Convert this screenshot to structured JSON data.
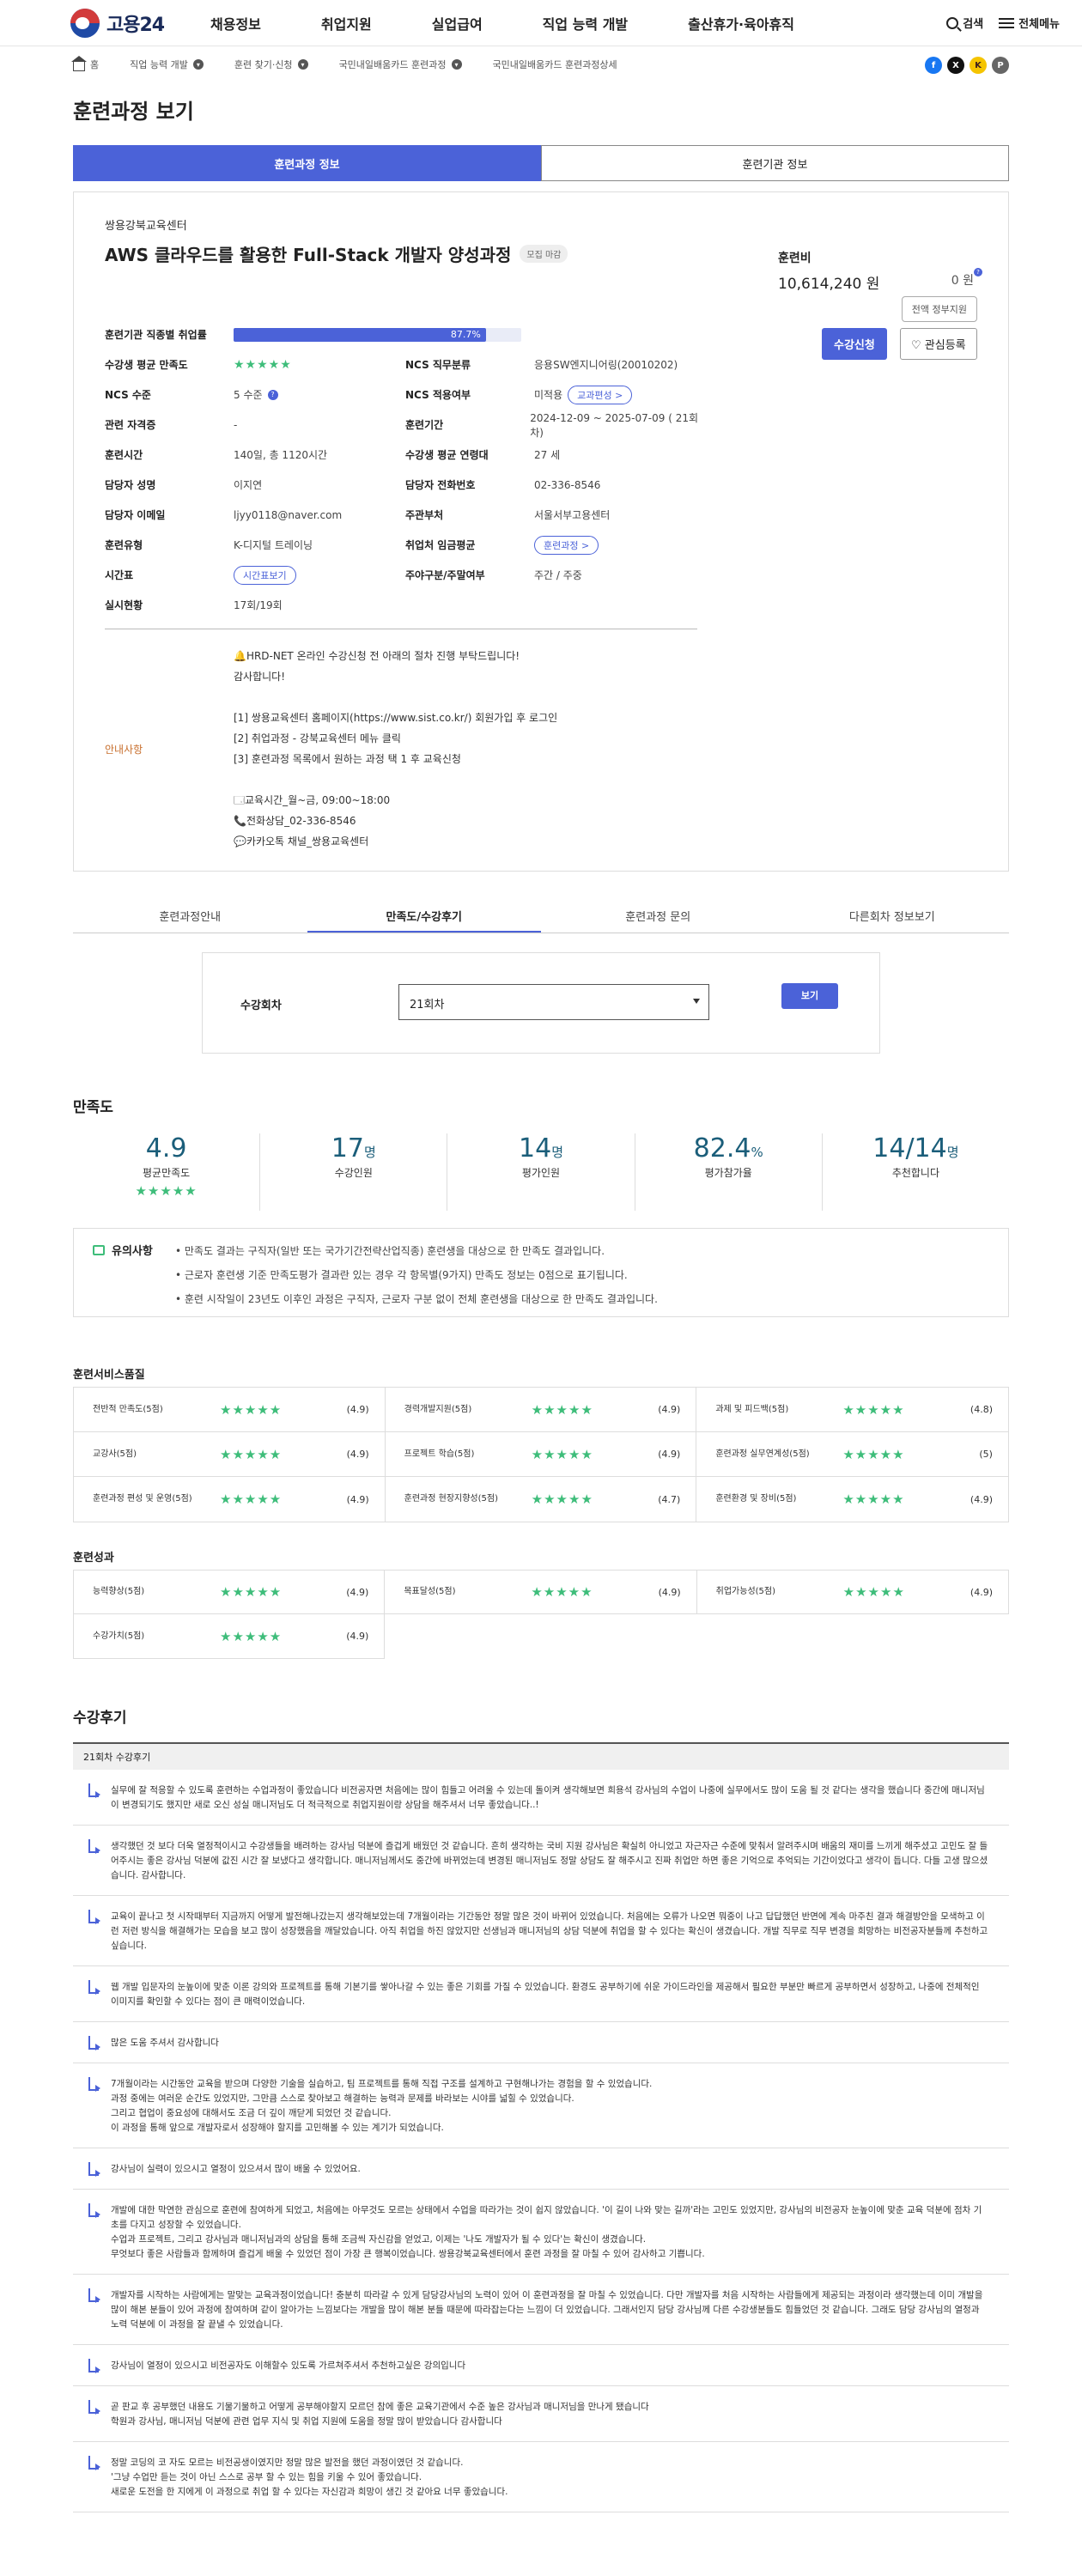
{
  "header": {
    "logo_text": "고용24",
    "menu": [
      "채용정보",
      "취업지원",
      "실업급여",
      "직업 능력 개발",
      "출산휴가·육아휴직"
    ],
    "search_label": "검색",
    "all_menu_label": "전체메뉴"
  },
  "breadcrumb": [
    "홈",
    "직업 능력 개발",
    "훈련 찾기·신청",
    "국민내일배움카드 훈련과정",
    "국민내일배움카드 훈련과정상세"
  ],
  "share": [
    "f",
    "X",
    "K",
    "P"
  ],
  "page_title": "훈련과정 보기",
  "main_tabs": [
    "훈련과정 정보",
    "훈련기관 정보"
  ],
  "course": {
    "org": "쌍용강북교육센터",
    "title": "AWS 클라우드를 활용한 Full-Stack 개발자 양성과정",
    "status": "모집 마감",
    "fee_label": "훈련비",
    "fee": "10,614,240 원",
    "self_pay": "0 원",
    "self_pay_info": "?",
    "all_pay_btn": "전액 정부지원",
    "apply_btn": "수강신청",
    "like_btn": "♡ 관심등록",
    "employment_label": "훈련기관 직종별 취업률",
    "employment_rate": 87.7,
    "employment_text": "87.7%",
    "rows": [
      [
        {
          "k": "수강생 평균 만족도",
          "v": "★★★★★",
          "type": "stars"
        },
        {
          "k": "NCS 직무분류",
          "v": "응용SW엔지니어링(20010202)"
        }
      ],
      [
        {
          "k": "NCS 수준",
          "v": "5 수준",
          "info": "?"
        },
        {
          "k": "NCS 적용여부",
          "v": "미적용",
          "pill": "교과편성 >"
        }
      ],
      [
        {
          "k": "관련 자격증",
          "v": "-"
        },
        {
          "k": "훈련기간",
          "v": "2024-12-09 ~ 2025-07-09 ( 21회차)"
        }
      ],
      [
        {
          "k": "훈련시간",
          "v": "140일, 총 1120시간"
        },
        {
          "k": "수강생 평균 연령대",
          "v": "27 세"
        }
      ],
      [
        {
          "k": "담당자 성명",
          "v": "이지연"
        },
        {
          "k": "담당자 전화번호",
          "v": "02-336-8546"
        }
      ],
      [
        {
          "k": "담당자 이메일",
          "v": "ljyy0118@naver.com"
        },
        {
          "k": "주관부처",
          "v": "서울서부고용센터"
        }
      ],
      [
        {
          "k": "훈련유형",
          "v": "K-디지털 트레이닝"
        },
        {
          "k": "취업처 임금평균",
          "v": "",
          "pill": "훈련과정 >"
        }
      ],
      [
        {
          "k": "시간표",
          "v": "",
          "pill": "시간표보기"
        },
        {
          "k": "주야구분/주말여부",
          "v": "주간 / 주중"
        }
      ],
      [
        {
          "k": "실시현황",
          "v": "17회/19회"
        }
      ]
    ],
    "notice_label": "안내사항",
    "notice_lines": [
      "🔔HRD-NET 온라인 수강신청 전 아래의 절차 진행 부탁드립니다!",
      "감사합니다!",
      "",
      "[1] 쌍용교육센터 홈페이지(https://www.sist.co.kr/) 회원가입 후 로그인",
      "[2] 취업과정 - 강북교육센터 메뉴 클릭",
      "[3] 훈련과정 목록에서 원하는 과정 택 1 후 교육신청",
      "",
      "🗔교육시간_월~금, 09:00~18:00",
      "📞전화상담_02-336-8546",
      "💬카카오톡 채널_쌍용교육센터"
    ]
  },
  "sub_tabs": [
    "훈련과정안내",
    "만족도/수강후기",
    "훈련과정 문의",
    "다른회차 정보보기"
  ],
  "round_select": {
    "label": "수강회차",
    "value": "21회차",
    "button": "보기"
  },
  "satisfaction": {
    "title": "만족도",
    "stats": [
      {
        "n": "4.9",
        "u": "",
        "l": "평균만족도",
        "stars": "★★★★★"
      },
      {
        "n": "17",
        "u": "명",
        "l": "수강인원"
      },
      {
        "n": "14",
        "u": "명",
        "l": "평가인원"
      },
      {
        "n": "82.4",
        "u": "%",
        "l": "평가참가율"
      },
      {
        "n": "14/14",
        "u": "명",
        "l": "추천합니다"
      }
    ],
    "caution_title": "유의사항",
    "caution": [
      "• 만족도 결과는 구직자(일반 또는 국가기간전략산업직종) 훈련생을 대상으로 한 만족도 결과입니다.",
      "• 근로자 훈련생 기준 만족도평가 결과란 있는 경우 각 항목별(9가지) 만족도 정보는 0점으로 표기됩니다.",
      "• 훈련 시작일이 23년도 이후인 과정은 구직자, 근로자 구분 없이 전체 훈련생을 대상으로 한 만족도 결과입니다."
    ]
  },
  "service_quality": {
    "title": "훈련서비스품질",
    "items": [
      {
        "n": "전반적 만족도(5점)",
        "s": "(4.9)"
      },
      {
        "n": "경력개발지원(5점)",
        "s": "(4.9)"
      },
      {
        "n": "과제 및 피드백(5점)",
        "s": "(4.8)"
      },
      {
        "n": "교강사(5점)",
        "s": "(4.9)"
      },
      {
        "n": "프로젝트 학습(5점)",
        "s": "(4.9)"
      },
      {
        "n": "훈련과정 실무연계성(5점)",
        "s": "(5)"
      },
      {
        "n": "훈련과정 편성 및 운영(5점)",
        "s": "(4.9)"
      },
      {
        "n": "훈련과정 현장지향성(5점)",
        "s": "(4.7)"
      },
      {
        "n": "훈련환경 및 장비(5점)",
        "s": "(4.9)"
      }
    ]
  },
  "outcome": {
    "title": "훈련성과",
    "items": [
      {
        "n": "능력향상(5점)",
        "s": "(4.9)"
      },
      {
        "n": "목표달성(5점)",
        "s": "(4.9)"
      },
      {
        "n": "취업가능성(5점)",
        "s": "(4.9)"
      },
      {
        "n": "수강가치(5점)",
        "s": "(4.9)"
      }
    ]
  },
  "reviews": {
    "title": "수강후기",
    "round": "21회차 수강후기",
    "items": [
      "실무에 잘 적응할 수 있도록 훈련하는 수업과정이 좋았습니다 비전공자면 처음에는 많이 힘들고 어려울 수 있는데 돌이켜 생각해보면 희용석 강사님의 수업이 나중에 실무에서도 많이 도움 될 것 같다는 생각을 했습니다 중간에 매니저님이 변경되기도 했지만 새로 오신 성실 매니저님도 더 적극적으로 취업지원이랑 상담을 해주셔서 너무 좋았습니다..!",
      "생각했던 것 보다 더욱 열정적이시고 수강생들을 배려하는 강사님 덕분에 즐겁게 배웠던 것 같습니다. 흔히 생각하는 국비 지원 강사님은 확실히 아니었고 자근자근 수준에 맞춰서 알려주시며 배움의 재미를 느끼게 해주셨고 고민도 잘 들어주시는 좋은 강사님 덕분에 값진 시간 잘 보냈다고 생각합니다. 매니저님께서도 중간에 바뀌었는데 변경된 매니저님도 정말 상담도 잘 해주시고 진짜 취업만 하면 좋은 기억으로 추억되는 기간이었다고 생각이 듭니다. 다들 고생 많으셨습니다. 감사합니다.",
      "교육이 끝나고 첫 시작때부터 지금까지 어떻게 발전해나갔는지 생각해보았는데 7개월이라는 기간동안 정말 많은 것이 바뀌어 있었습니다. 처음에는 오류가 나오면 뭐중이 나고 답답했던 반면에 계속 마주친 결과 해결방안을 모색하고 이런 저런 방식을 해결해가는 모습을 보고 많이 성장했음을 깨달았습니다. 아직 취업을 하진 않았지만 선생님과 매니저님의 상담 덕분에 취업을 할 수 있다는 확신이 생겼습니다. 개발 직무로 직무 변경을 희망하는 비전공자분들께 추천하고 싶습니다.",
      "웹 개발 입문자의 눈높이에 맞춘 이론 강의와 프로젝트를 통해 기본기를 쌓아나갈 수 있는 좋은 기회를 가질 수 있었습니다. 환경도 공부하기에 쉬운 가이드라인을 제공해서 필요한 부분만 빠르게 공부하면서 성장하고, 나중에 전체적인 이미지를 확인할 수 있다는 점이 큰 매력이었습니다.",
      "많은 도움 주셔서 감사합니다",
      "7개월이라는 시간동안 교육을 받으며 다양한 기술을 실습하고, 팀 프로젝트를 통해 직접 구조를 설계하고 구현해나가는 경험을 할 수 있었습니다.\n과정 중에는 여러운 순간도 있었지만, 그만큼 스스로 찾아보고 해결하는 능력과 문제를 바라보는 시야를 넓힐 수 있었습니다.\n그리고 협업이 중요성에 대해서도 조금 더 깊이 깨닫게 되었던 것 같습니다.\n이 과정을 통해 앞으로 개발자로서 성장해야 할지를 고민해볼 수 있는 계기가 되었습니다.",
      "강사님이 실력이 있으시고 열정이 있으셔서 많이 배울 수 있었어요.",
      "개발에 대한 막연한 관심으로 훈련에 참여하게 되었고, 처음에는 아무것도 모르는 상태에서 수업을 따라가는 것이 쉽지 않았습니다. '이 길이 나와 맞는 길까'라는 고민도 있었지만, 강사님의 비전공자 눈높이에 맞춘 교육 덕분에 점차 기초를 다지고 성장할 수 있었습니다.\n수업과 프로젝트, 그리고 강사님과 매니저님과의 상담을 통해 조금씩 자신감을 얻었고, 이제는 '나도 개발자가 될 수 있다'는 확신이 생겼습니다.\n무엇보다 좋은 사람들과 함께하며 즐겁게 배울 수 있었던 점이 가장 큰 행복이었습니다. 쌍용강북교육센터에서 훈련 과정을 잘 마칠 수 있어 감사하고 기쁩니다.",
      "개발자를 시작하는 사람에게는 말맞는 교육과정이었습니다! 충분히 따라갈 수 있게 담당강사님의 노력이 있어 이 훈련과정을 잘 마칠 수 있었습니다. 다만 개발자를 처음 시작하는 사람들에게 제공되는 과정이라 생각했는데 이미 개발을 많이 해본 분들이 있어 과정에 참여하며 같이 알아가는 느낌보다는 개발을 많이 해본 분들 때문에 따라잡는다는 느낌이 더 있었습니다. 그래서인지 담당 강사님께 다른 수강생분들도 힘들었던 것 같습니다. 그래도 담당 강사님의 열정과 노력 덕분에 이 과정을 잘 끝낼 수 있었습니다.",
      "강사님이 열정이 있으시고 비전공자도 이해할수 있도록 가르쳐주셔서 추천하고싶은 강의입니다",
      "곧 판교 후 공부했던 내용도 기물기물하고 어떻게 공부해야할지 모르던 참에 좋은 교육기관에서 수준 높은 강사님과 매니저님을 만나게 됐습니다\n학원과 강사님, 매니저님 덕분에 관련 업무 지식 및 취업 지원에 도움을 정말 많이 받았습니다 감사합니다",
      "정말 코딩의 코 자도 모르는 비전공생이였지만 정말 많은 발전을 했던 과정이였던 것 같습니다.\n'그냥 수업만 듣는 것이 아닌 스스로 공부 할 수 있는 힘을 키울 수 있어 좋았습니다.\n새로운 도전을 한 지에게 이 과정으로 취업 할 수 있다는 자신감과 희망이 생긴 것 같아요 너무 좋았습니다."
    ]
  }
}
